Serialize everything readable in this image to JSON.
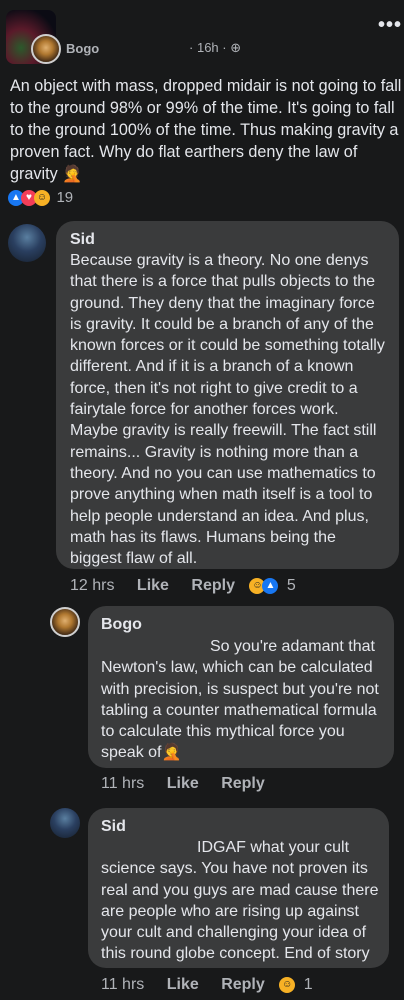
{
  "post": {
    "author": "Bogo",
    "time": "16h",
    "separator": "·",
    "text_lines": [
      "An object with mass, dropped midair is not going to fall",
      "to the ground 98% or 99% of the time. It's going to fall",
      "to the ground 100% of the time. Thus making gravity a",
      "proven fact. Why do flat earthers deny the law of",
      "gravity 🤦"
    ],
    "reaction_count": "19",
    "more_label": "•••"
  },
  "comments": [
    {
      "author": "Sid",
      "lines": [
        "Because gravity is a theory. No one denys",
        "that there is a force that pulls objects to the",
        "ground. They deny that the imaginary force",
        "is gravity. It could be a branch of any of the",
        "known forces or it could be something totally",
        "different. And if it is a branch of a known",
        "force, then it's not right to give credit to a",
        "fairytale force for another forces work.",
        "Maybe gravity is really freewill. The fact still",
        "remains... Gravity is nothing more than a",
        "theory.  And no you can use mathematics to",
        "prove anything when math itself is a tool to",
        "help people understand an idea. And plus,",
        "math has its flaws. Humans being the",
        "biggest flaw of all."
      ],
      "time": "12 hrs",
      "like": "Like",
      "reply": "Reply",
      "reaction_count": "5"
    },
    {
      "author": "Bogo",
      "lines": [
        "So you're adamant that",
        "Newton's law, which can be calculated",
        "with precision, is suspect but you're not",
        "tabling a counter mathematical formula",
        "to calculate this mythical force you",
        "speak of🤦"
      ],
      "time": "11 hrs",
      "like": "Like",
      "reply": "Reply"
    },
    {
      "author": "Sid",
      "lines": [
        "IDGAF  what your cult",
        "science says. You have not proven its",
        "real and  you guys are mad cause there",
        "are people who are rising up against",
        "your cult and challenging your idea of",
        "this round globe concept. End of story"
      ],
      "time": "11 hrs",
      "like": "Like",
      "reply": "Reply",
      "reaction_count": "1"
    }
  ],
  "icons": {
    "like": "👍",
    "love": "♥",
    "haha": "😆",
    "globe": "⊕"
  }
}
